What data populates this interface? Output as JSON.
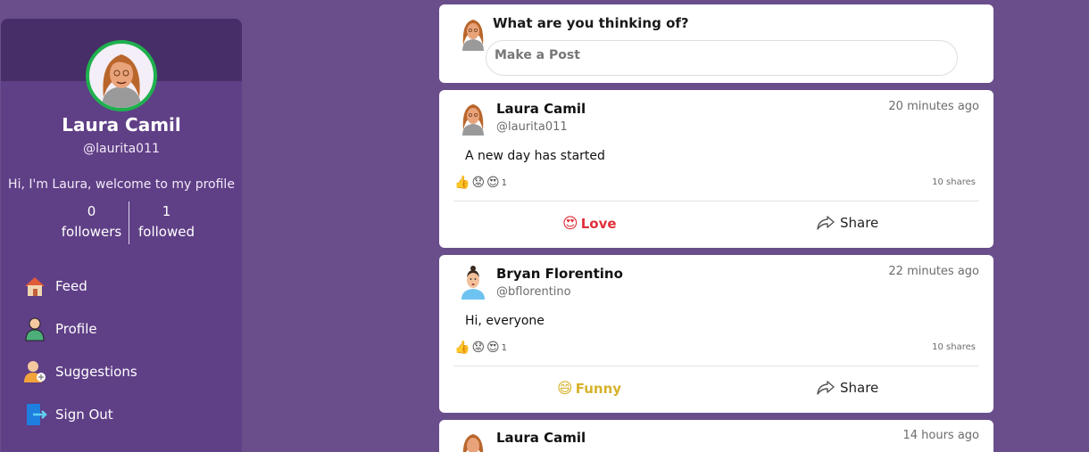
{
  "profile": {
    "name": "Laura Camil",
    "handle": "@laurita011",
    "bio": "Hi, I'm Laura, welcome to my profile",
    "followers_count": "0",
    "followers_label": "followers",
    "followed_count": "1",
    "followed_label": "followed"
  },
  "nav": [
    {
      "label": "Feed",
      "icon": "home-icon"
    },
    {
      "label": "Profile",
      "icon": "user-icon"
    },
    {
      "label": "Suggestions",
      "icon": "add-user-icon"
    },
    {
      "label": "Sign Out",
      "icon": "sign-out-icon"
    }
  ],
  "composer": {
    "question": "What are you thinking of?",
    "placeholder": "Make a Post"
  },
  "posts": [
    {
      "author": "Laura Camil",
      "handle": "@laurita011",
      "time": "20 minutes ago",
      "text": "A new day has started",
      "reaction_count": "1",
      "shares": "10 shares",
      "my_reaction_label": "Love",
      "my_reaction_emoji": "😍",
      "share_label": "Share"
    },
    {
      "author": "Bryan Florentino",
      "handle": "@bflorentino",
      "time": "22 minutes ago",
      "text": "Hi, everyone",
      "reaction_count": "1",
      "shares": "10 shares",
      "my_reaction_label": "Funny",
      "my_reaction_emoji": "😄",
      "share_label": "Share"
    },
    {
      "author": "Laura Camil",
      "time": "14 hours ago"
    }
  ],
  "reaction_icons": [
    "👍",
    "😟",
    "😍"
  ],
  "colors": {
    "background": "#6a4e8c",
    "sidebar": "#5f3f86",
    "sidebar_banner": "#472e68",
    "avatar_ring": "#1fb04e",
    "love": "#e0303a",
    "funny": "#d6b22b"
  }
}
